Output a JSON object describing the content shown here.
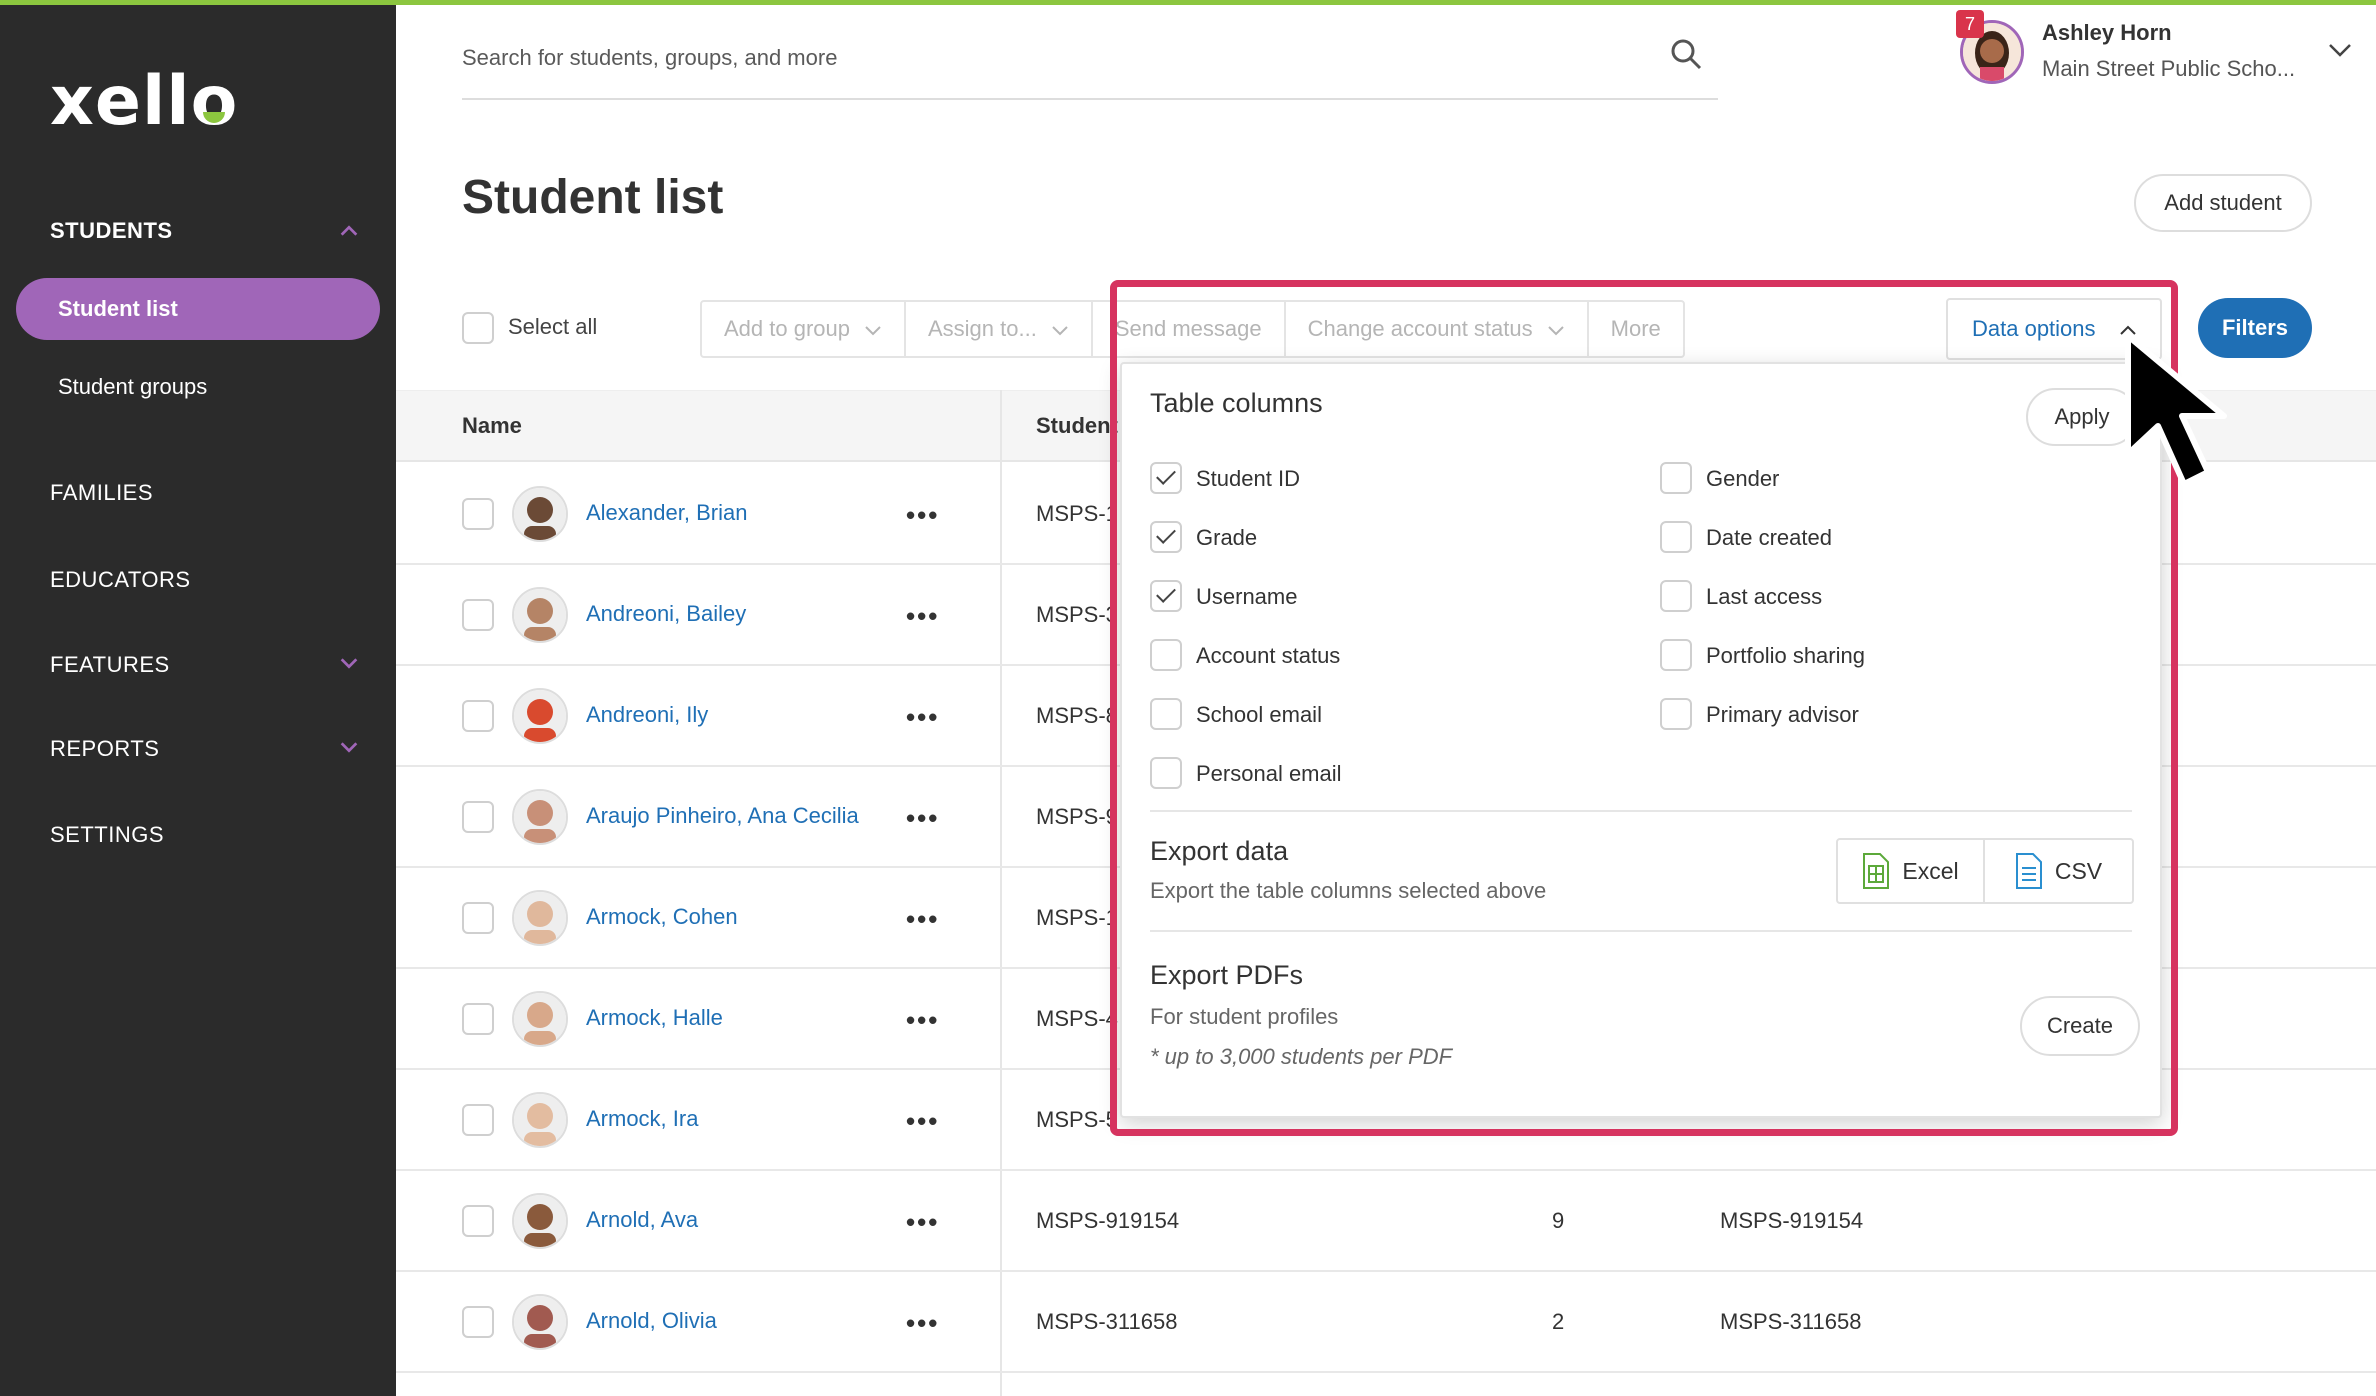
{
  "brand": {
    "logo": "xello",
    "accent": "#8cc63f",
    "highlight": "#d6335f",
    "primary": "#1f6fb5",
    "nav_active": "#a066b8"
  },
  "sidebar": {
    "students_section": "STUDENTS",
    "items": [
      {
        "label": "Student list"
      },
      {
        "label": "Student groups"
      }
    ],
    "families": "FAMILIES",
    "educators": "EDUCATORS",
    "features": "FEATURES",
    "reports": "REPORTS",
    "settings": "SETTINGS"
  },
  "search": {
    "placeholder": "Search for students, groups, and more"
  },
  "user": {
    "name": "Ashley Horn",
    "school": "Main Street Public Scho...",
    "notifications": "7"
  },
  "page": {
    "title": "Student list",
    "add_student": "Add student"
  },
  "toolbar": {
    "select_all": "Select all",
    "add_to_group": "Add to group",
    "assign_to": "Assign to...",
    "send_message": "Send message",
    "change_account_status": "Change account status",
    "more": "More",
    "data_options": "Data options",
    "filters": "Filters"
  },
  "table": {
    "headers": {
      "name": "Name",
      "student_id": "Student ID"
    },
    "rows": [
      {
        "name": "Alexander, Brian",
        "sid": "MSPS-1",
        "grade": "",
        "username": "",
        "avatar": "#6b4a36"
      },
      {
        "name": "Andreoni, Bailey",
        "sid": "MSPS-3",
        "grade": "",
        "username": "",
        "avatar": "#b58466"
      },
      {
        "name": "Andreoni, Ily",
        "sid": "MSPS-8",
        "grade": "",
        "username": "",
        "avatar": "#d94a2e"
      },
      {
        "name": "Araujo Pinheiro, Ana Cecilia",
        "sid": "MSPS-9",
        "grade": "",
        "username": "",
        "avatar": "#c89078"
      },
      {
        "name": "Armock, Cohen",
        "sid": "MSPS-1",
        "grade": "",
        "username": "",
        "avatar": "#e0b89c"
      },
      {
        "name": "Armock, Halle",
        "sid": "MSPS-4",
        "grade": "",
        "username": "",
        "avatar": "#d8a88a"
      },
      {
        "name": "Armock, Ira",
        "sid": "MSPS-5",
        "grade": "",
        "username": "",
        "avatar": "#e3bca0"
      },
      {
        "name": "Arnold, Ava",
        "sid": "MSPS-919154",
        "grade": "9",
        "username": "MSPS-919154",
        "avatar": "#8a5a3c"
      },
      {
        "name": "Arnold, Olivia",
        "sid": "MSPS-311658",
        "grade": "2",
        "username": "MSPS-311658",
        "avatar": "#a15a50"
      }
    ]
  },
  "data_options_panel": {
    "table_columns": "Table columns",
    "apply": "Apply",
    "columns_left": [
      {
        "label": "Student ID",
        "checked": true
      },
      {
        "label": "Grade",
        "checked": true
      },
      {
        "label": "Username",
        "checked": true
      },
      {
        "label": "Account status",
        "checked": false
      },
      {
        "label": "School email",
        "checked": false
      },
      {
        "label": "Personal email",
        "checked": false
      }
    ],
    "columns_right": [
      {
        "label": "Gender",
        "checked": false
      },
      {
        "label": "Date created",
        "checked": false
      },
      {
        "label": "Last access",
        "checked": false
      },
      {
        "label": "Portfolio sharing",
        "checked": false
      },
      {
        "label": "Primary advisor",
        "checked": false
      }
    ],
    "export_data": "Export data",
    "export_data_sub": "Export the table columns selected above",
    "excel": "Excel",
    "csv": "CSV",
    "export_pdfs": "Export PDFs",
    "export_pdfs_sub": "For student profiles",
    "export_pdfs_note": "* up to 3,000 students per PDF",
    "create": "Create"
  },
  "icons": [
    "search-icon",
    "chevron-up-icon",
    "chevron-down-icon",
    "excel-icon",
    "csv-icon",
    "cursor-icon",
    "kebab-icon"
  ]
}
